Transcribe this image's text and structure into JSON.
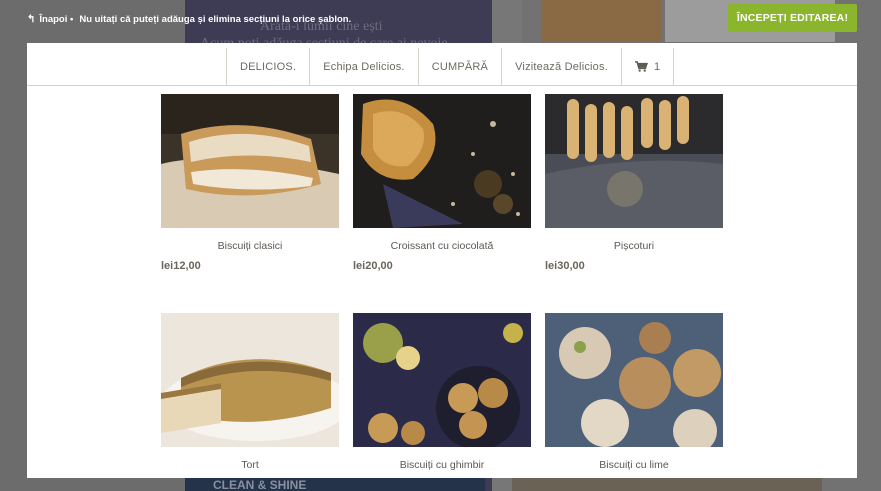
{
  "background": {
    "panel_text_line1": "Arată-i lumii cine ești",
    "panel_text_line2": "Acum poți adăuga secțiuni de care ai nevoie",
    "bottom_banner": "CLEAN & SHINE"
  },
  "topbar": {
    "back_label": "Înapoi",
    "note_text": "Nu uitați că puteți adăuga și elimina secțiuni la orice șablon.",
    "start_button_label": "ÎNCEPEȚI EDITAREA!"
  },
  "nav": {
    "items": [
      "DELICIOS.",
      "Echipa Delicios.",
      "CUMPĂRĂ",
      "Vizitează Delicios."
    ],
    "cart_count": "1",
    "cart_icon": "shopping-cart-icon"
  },
  "products": [
    {
      "name": "Biscuiți clasici",
      "price": "lei12,00"
    },
    {
      "name": "Croissant cu ciocolată",
      "price": "lei20,00"
    },
    {
      "name": "Pișcoturi",
      "price": "lei30,00"
    },
    {
      "name": "Tort",
      "price": ""
    },
    {
      "name": "Biscuiți cu ghimbir",
      "price": ""
    },
    {
      "name": "Biscuiți cu lime",
      "price": ""
    }
  ],
  "colors": {
    "accent_button": "#8bb52c",
    "overlay": "#6a6a6a",
    "text_muted": "#6e6a62"
  }
}
